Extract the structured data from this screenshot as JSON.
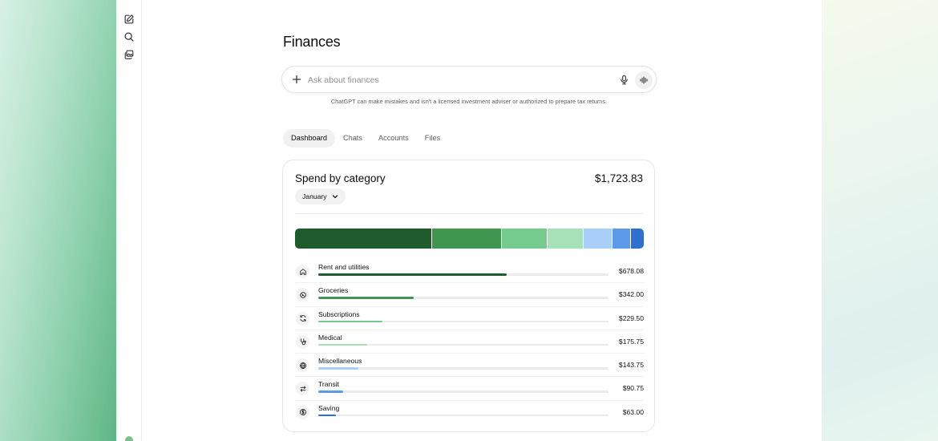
{
  "page": {
    "title": "Finances"
  },
  "sidebar": {
    "icons": [
      "new-chat-icon",
      "search-icon",
      "images-icon"
    ]
  },
  "search": {
    "placeholder": "Ask about finances",
    "disclaimer": "ChatGPT can make mistakes and isn't a licensed investment adviser or authorized to prepare tax returns."
  },
  "tabs": [
    {
      "label": "Dashboard",
      "active": true
    },
    {
      "label": "Chats",
      "active": false
    },
    {
      "label": "Accounts",
      "active": false
    },
    {
      "label": "Files",
      "active": false
    }
  ],
  "card": {
    "title": "Spend by category",
    "total": "$1,723.83",
    "month": "January",
    "categories": [
      {
        "label": "Rent and utilities",
        "amount": "$678.08",
        "value": 678.08,
        "color": "#1f5b2b",
        "icon": "home-icon"
      },
      {
        "label": "Groceries",
        "amount": "$342.00",
        "value": 342.0,
        "color": "#3e9651",
        "icon": "groceries-icon"
      },
      {
        "label": "Subscriptions",
        "amount": "$229.50",
        "value": 229.5,
        "color": "#74cb8d",
        "icon": "refresh-icon"
      },
      {
        "label": "Medical",
        "amount": "$175.75",
        "value": 175.75,
        "color": "#a7e1b7",
        "icon": "stethoscope-icon"
      },
      {
        "label": "Miscellaneous",
        "amount": "$143.75",
        "value": 143.75,
        "color": "#a9cff8",
        "icon": "globe-icon"
      },
      {
        "label": "Transit",
        "amount": "$90.75",
        "value": 90.75,
        "color": "#5a9ae8",
        "icon": "arrows-exchange-icon"
      },
      {
        "label": "Saving",
        "amount": "$63.00",
        "value": 63.0,
        "color": "#2f6fcf",
        "icon": "dollar-circle-icon"
      }
    ]
  }
}
